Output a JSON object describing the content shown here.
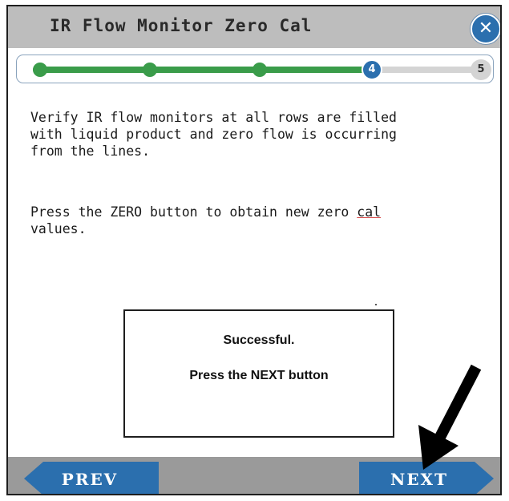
{
  "window": {
    "title": "IR Flow Monitor Zero Cal",
    "close_symbol": "✕"
  },
  "progress": {
    "current_step": "4",
    "last_step": "5",
    "fraction_complete": 0.75
  },
  "content": {
    "paragraph1": "Verify IR flow monitors at all rows are filled\nwith liquid product and zero flow is occurring\nfrom the lines.",
    "paragraph2_part1": "Press the ZERO button to obtain new zero ",
    "paragraph2_underlined": "cal",
    "paragraph2_part2": "\nvalues."
  },
  "dialog": {
    "line1": "Successful.",
    "line2": "Press the NEXT button"
  },
  "footer": {
    "prev_label": "PREV",
    "next_label": "NEXT"
  },
  "colors": {
    "accent_blue": "#2b6fae",
    "progress_green": "#3a9c4a",
    "title_bar_gray": "#bdbdbd",
    "footer_gray": "#9a9a9a"
  }
}
